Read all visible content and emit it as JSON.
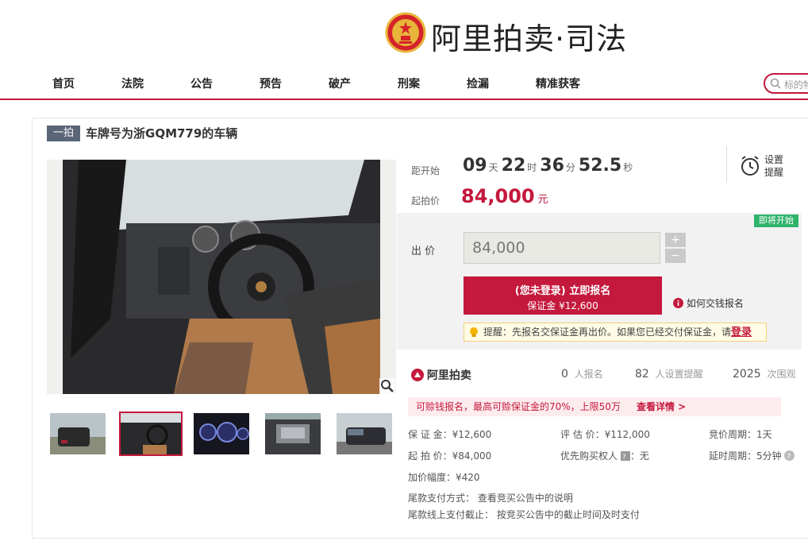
{
  "header": {
    "logo_text": "阿里拍卖·司法",
    "nav": [
      "首页",
      "法院",
      "公告",
      "预告",
      "破产",
      "刑案",
      "捡漏",
      "精准获客"
    ],
    "search_placeholder": "标的物"
  },
  "item": {
    "tag": "一拍",
    "title": "车牌号为浙GQM779的车辆"
  },
  "countdown": {
    "label": "距开始",
    "days": "09",
    "days_unit": "天",
    "hours": "22",
    "hours_unit": "时",
    "minutes": "36",
    "minutes_unit": "分",
    "seconds": "52.5",
    "seconds_unit": "秒",
    "reminder_label_1": "设置",
    "reminder_label_2": "提醒"
  },
  "start_price": {
    "label": "起拍价",
    "value": "84,000",
    "unit": "元"
  },
  "bid": {
    "status_badge": "即将开始",
    "label": "出 价",
    "input_value": "84,000",
    "plus": "+",
    "minus": "−",
    "apply_line1": "(您未登录) 立即报名",
    "apply_line2": "保证金 ¥12,600",
    "how_to_pay": "如何交钱报名",
    "reminder_text": "提醒：先报名交保证金再出价。如果您已经交付保证金，请",
    "reminder_login": "登录"
  },
  "stats": {
    "brand": "阿里拍卖",
    "signups_num": "0",
    "signups_label": "人报名",
    "reminders_num": "82",
    "reminders_label": "人设置提醒",
    "views_num": "2025",
    "views_label": "次围观"
  },
  "promo": {
    "text": "可赊钱报名，最高可赊保证金的70%，上限50万",
    "link": "查看详情 >"
  },
  "info": {
    "deposit": "保 证 金：¥12,600",
    "appraisal": "评 估 价：¥112,000",
    "cycle": "竞价周期：1天",
    "start_price": "起 拍 价：¥84,000",
    "priority": "优先购买权人",
    "priority_val": "：无",
    "delay": "延时周期：5分钟",
    "increment": "加价幅度：¥420",
    "payment_method": "尾款支付方式： 查看竞买公告中的说明",
    "payment_deadline": "尾款线上支付截止： 按竞买公告中的截止时间及时支付"
  }
}
